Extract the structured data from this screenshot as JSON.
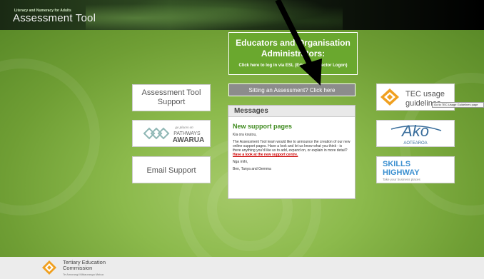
{
  "header": {
    "tagline": "Literacy and Numeracy for Adults",
    "app_title": "Assessment Tool"
  },
  "educators": {
    "title_line1": "Educators and Organisation",
    "title_line2": "Administrators:",
    "login_link": "Click here to log in via ESL (Education Sector Logon)"
  },
  "sitting_button": "Sitting an Assessment? Click here",
  "messages": {
    "header": "Messages",
    "title": "New support pages",
    "greeting": "Kia ora koutou,",
    "body": "The Assessment Tool team would like to announce the creation of our new online support pages. Have a look and let us know what you think - is there anything you'd like us to add, expand on, or explain in more detail?",
    "link_text": "Have a look at the new support centre.",
    "signoff": "Nga mihi,",
    "signature": "Ben, Tanya and Gemma"
  },
  "left_buttons": {
    "support_line1": "Assessment Tool",
    "support_line2": "Support",
    "pathways_tag": "go places on",
    "pathways_line1": "PATHWAYS",
    "pathways_line2": "AWARUA",
    "email": "Email Support"
  },
  "right_links": {
    "tec_line1": "TEC usage",
    "tec_line2": "guidelines",
    "tooltip": "Go to TEC Usage Guidelines page",
    "ako_name": "Ako",
    "ako_sub": "AOTEAROA",
    "skills_line1": "SKILLS",
    "skills_line2": "HIGHWAY",
    "skills_tagline": "Take your business places"
  },
  "footer": {
    "org_line1": "Tertiary Education",
    "org_line2": "Commission",
    "org_maori": "Te Amorangi Mātauranga Matua"
  },
  "colors": {
    "green_bg": "#8cba4c",
    "edu_box": "#6aa82e",
    "message_title": "#3e8a1e",
    "tec_orange": "#f0a020",
    "skills_blue": "#3a8fd0"
  }
}
